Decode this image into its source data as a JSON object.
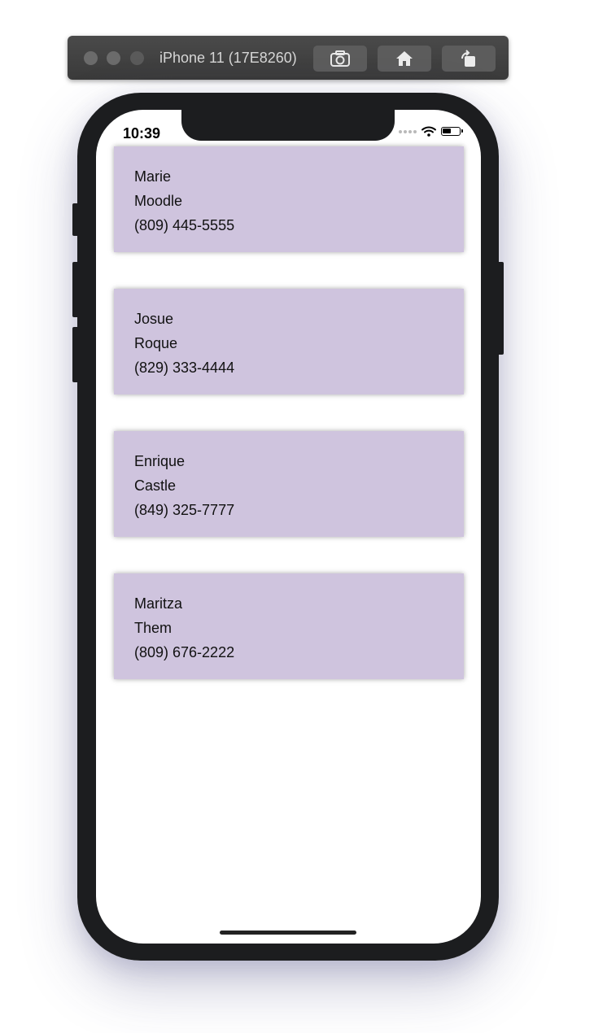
{
  "simulator": {
    "title": "iPhone 11 (17E8260)",
    "buttons": [
      {
        "name": "screenshot-button",
        "icon": "camera-icon"
      },
      {
        "name": "home-button",
        "icon": "home-icon"
      },
      {
        "name": "rotate-button",
        "icon": "rotate-icon"
      }
    ]
  },
  "status_bar": {
    "time": "10:39",
    "battery_level": 0.55
  },
  "contacts": [
    {
      "first_name": "Marie",
      "last_name": "Moodle",
      "phone": "(809) 445-5555"
    },
    {
      "first_name": "Josue",
      "last_name": "Roque",
      "phone": "(829) 333-4444"
    },
    {
      "first_name": "Enrique",
      "last_name": "Castle",
      "phone": "(849) 325-7777"
    },
    {
      "first_name": "Maritza",
      "last_name": "Them",
      "phone": "(809) 676-2222"
    }
  ],
  "colors": {
    "card_background": "#cfc4de",
    "phone_body": "#1c1d1f",
    "simulator_bar": "#3f3f3f"
  }
}
